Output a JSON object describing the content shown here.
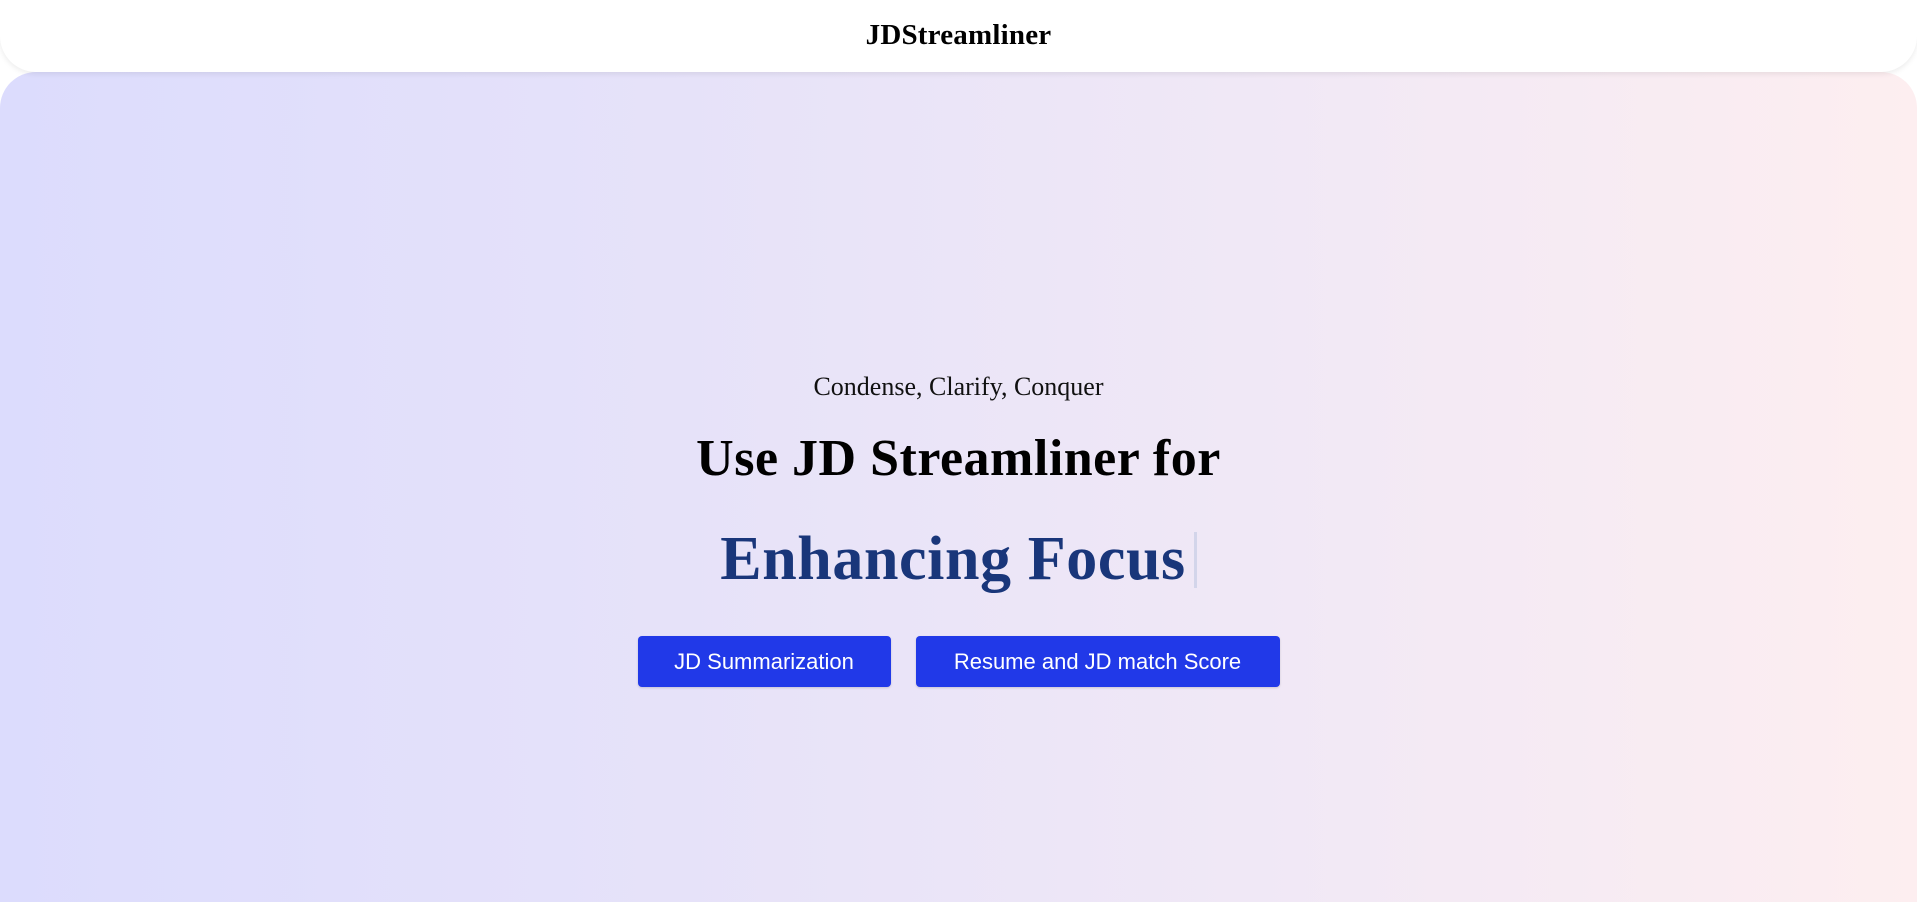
{
  "header": {
    "brand": "JDStreamliner"
  },
  "hero": {
    "tagline": "Condense, Clarify, Conquer",
    "headline": "Use JD Streamliner for",
    "typing_text": "Enhancing Focus"
  },
  "actions": {
    "summarize_label": "JD Summarization",
    "match_label": "Resume and JD match Score"
  },
  "colors": {
    "button": "#2139e8",
    "typing_text": "#19367a",
    "gradient_start": "#dcdcfd",
    "gradient_end": "#fdeef0"
  }
}
